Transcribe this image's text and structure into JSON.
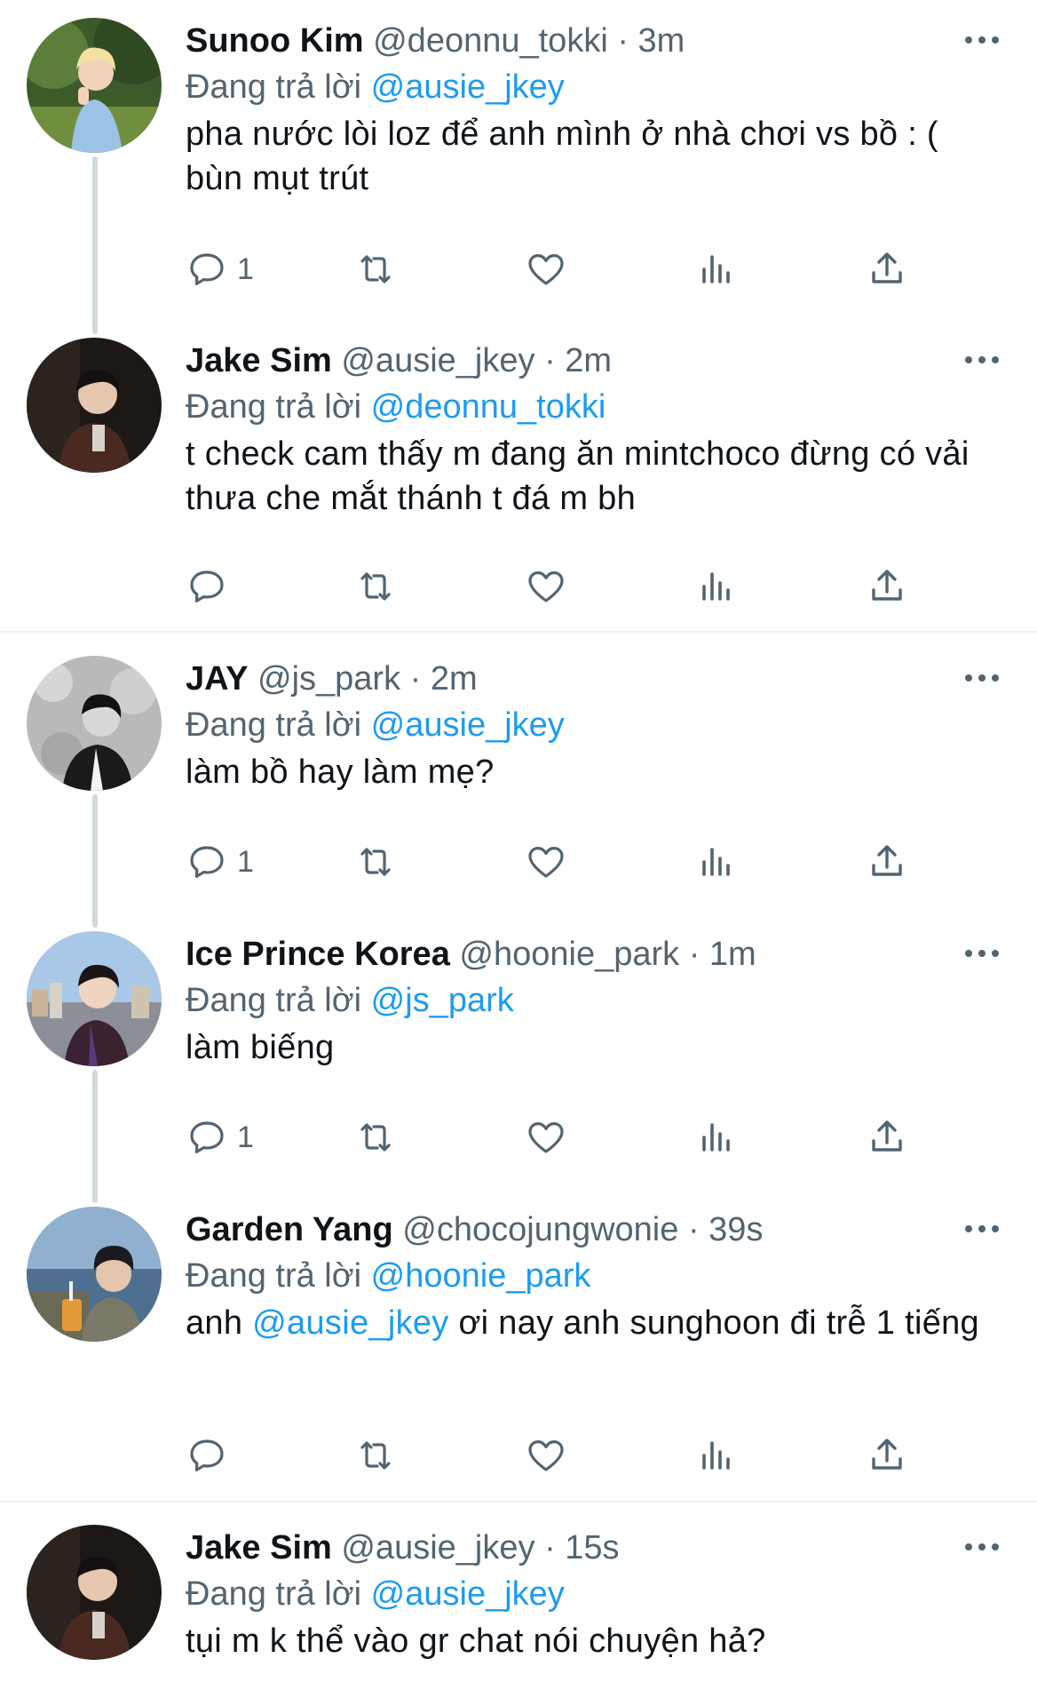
{
  "reply_prefix": "Đang trả lời",
  "tweets": [
    {
      "name": "Sunoo Kim",
      "handle": "@deonnu_tokki",
      "time": "3m",
      "reply_to": "@ausie_jkey",
      "text": "pha nước lòi loz để anh mình ở nhà chơi vs bồ : ( bùn mụt trút",
      "reply_count": "1"
    },
    {
      "name": "Jake Sim",
      "handle": "@ausie_jkey",
      "time": "2m",
      "reply_to": "@deonnu_tokki",
      "text": "t check cam thấy m đang ăn mintchoco đừng có vải thưa che mắt thánh t đá m bh",
      "reply_count": ""
    },
    {
      "name": "JAY",
      "handle": "@js_park",
      "time": "2m",
      "reply_to": "@ausie_jkey",
      "text": "làm bồ hay làm mẹ?",
      "reply_count": "1"
    },
    {
      "name": "Ice Prince Korea",
      "handle": "@hoonie_park",
      "time": "1m",
      "reply_to": "@js_park",
      "text": "làm biếng",
      "reply_count": "1"
    },
    {
      "name": "Garden Yang",
      "handle": "@chocojungwonie",
      "time": "39s",
      "reply_to": "@hoonie_park",
      "text_before": "anh ",
      "text_mention": "@ausie_jkey",
      "text_after": " ơi nay anh sunghoon đi trễ 1 tiếng",
      "reply_count": ""
    },
    {
      "name": "Jake Sim",
      "handle": "@ausie_jkey",
      "time": "15s",
      "reply_to": "@ausie_jkey",
      "text": "tụi m k thể vào gr chat nói chuyện hả?",
      "reply_count": ""
    }
  ],
  "icons": {
    "reply": "speech-bubble-icon",
    "retweet": "retweet-icon",
    "like": "heart-icon",
    "views": "bar-chart-icon",
    "share": "share-upload-icon",
    "more": "ellipsis-icon"
  },
  "colors": {
    "mention": "#1d9bf0",
    "secondary_text": "#536471",
    "thread_line": "#cfd9de",
    "divider": "#eff3f4"
  }
}
